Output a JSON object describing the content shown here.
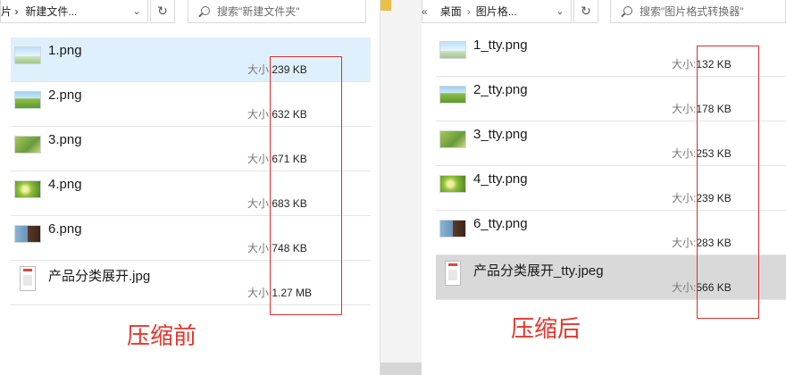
{
  "left_window": {
    "address_prefix": "片 ›",
    "address_path": "新建文件...",
    "search_placeholder": "搜索\"新建文件夹\"",
    "caption": "压缩前",
    "files": [
      {
        "name": "1.png",
        "size_label": "大小:",
        "size": "239 KB",
        "thumb": "sky-icon",
        "selected": true
      },
      {
        "name": "2.png",
        "size_label": "大小:",
        "size": "632 KB",
        "thumb": "field-icon",
        "selected": false
      },
      {
        "name": "3.png",
        "size_label": "大小:",
        "size": "671 KB",
        "thumb": "grass-icon",
        "selected": false
      },
      {
        "name": "4.png",
        "size_label": "大小:",
        "size": "683 KB",
        "thumb": "flowers-icon",
        "selected": false
      },
      {
        "name": "6.png",
        "size_label": "大小:",
        "size": "748 KB",
        "thumb": "portrait-icon",
        "selected": false
      },
      {
        "name": "产品分类展开.jpg",
        "size_label": "大小:",
        "size": "1.27 MB",
        "thumb": "document-icon",
        "selected": false
      }
    ]
  },
  "right_window": {
    "address_prefix": "«",
    "address_path_1": "桌面",
    "address_path_2": "图片格...",
    "search_placeholder": "搜索\"图片格式转换器\"",
    "caption": "压缩后",
    "files": [
      {
        "name": "1_tty.png",
        "size_label": "大小:",
        "size": "132 KB",
        "thumb": "sky-icon",
        "selected": false
      },
      {
        "name": "2_tty.png",
        "size_label": "大小:",
        "size": "178 KB",
        "thumb": "field-icon",
        "selected": false
      },
      {
        "name": "3_tty.png",
        "size_label": "大小:",
        "size": "253 KB",
        "thumb": "grass-icon",
        "selected": false
      },
      {
        "name": "4_tty.png",
        "size_label": "大小:",
        "size": "239 KB",
        "thumb": "flowers-icon",
        "selected": false
      },
      {
        "name": "6_tty.png",
        "size_label": "大小:",
        "size": "283 KB",
        "thumb": "portrait-icon",
        "selected": false
      },
      {
        "name": "产品分类展开_tty.jpeg",
        "size_label": "大小:",
        "size": "566 KB",
        "thumb": "document-icon",
        "selected": true
      }
    ]
  },
  "colors": {
    "accent_red": "#e8342a",
    "selection_blue": "#dff0fd",
    "selection_gray": "#d9d9d9"
  }
}
